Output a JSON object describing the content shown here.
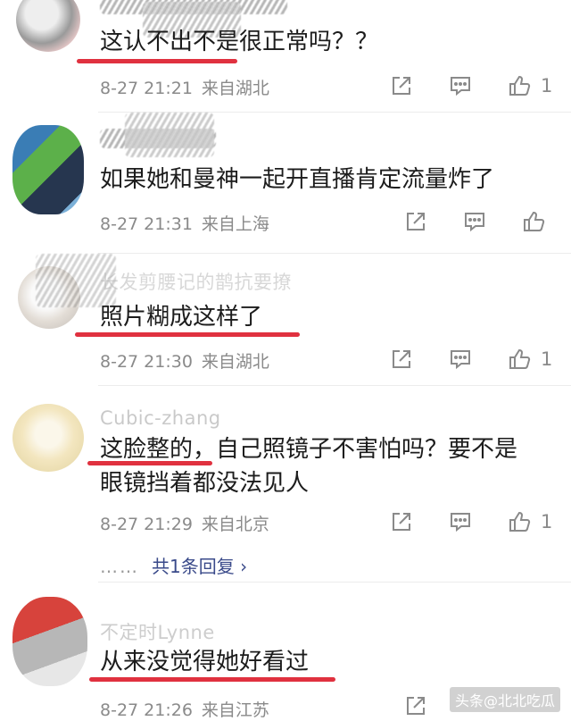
{
  "comments": [
    {
      "username": "",
      "text_lines": [
        "这认不出不是很正常吗？？"
      ],
      "date": "8-27 21:21",
      "location": "来自湖北",
      "likes": "1",
      "avatar_colors": [
        "#7e7e7e",
        "#e9e9e9",
        "#f1c9c9"
      ]
    },
    {
      "username": "",
      "text_lines": [
        "如果她和曼神一起开直播肯定流量炸了"
      ],
      "date": "8-27 21:31",
      "location": "来自上海",
      "likes": "",
      "avatar_colors": [
        "#3a7db5",
        "#5cb04a",
        "#26364f"
      ]
    },
    {
      "username": "长发剪腰记的鹊抗要撩",
      "text_lines": [
        "照片糊成这样了"
      ],
      "date": "8-27 21:30",
      "location": "来自湖北",
      "likes": "1",
      "avatar_colors": [
        "#e8e2dc",
        "#c9c3bd",
        "#fafafa"
      ]
    },
    {
      "username": "Cubic-zhang",
      "text_lines": [
        "这脸整的，自己照镜子不害怕吗？要不是",
        "眼镜挡着都没法见人"
      ],
      "date": "8-27 21:29",
      "location": "来自北京",
      "likes": "1",
      "reply_dots": "……",
      "reply_label": "共1条回复 ›",
      "avatar_colors": [
        "#f3e6bf",
        "#e7d9a9",
        "#fbf7ea"
      ]
    },
    {
      "username": "不定时Lynne",
      "text_lines": [
        "从来没觉得她好看过"
      ],
      "date": "8-27 21:26",
      "location": "来自江苏",
      "likes": "",
      "avatar_colors": [
        "#d7433c",
        "#9b9b9b",
        "#e7e7e7"
      ]
    }
  ],
  "watermark": "头条@北北吃瓜",
  "icons": {
    "share": "share-icon",
    "comment": "comment-icon",
    "like": "thumbs-up-icon"
  },
  "colors": {
    "highlight_underline": "#e0313f",
    "reply_link": "#3a4a8a",
    "meta_gray": "#8a8a8a"
  }
}
